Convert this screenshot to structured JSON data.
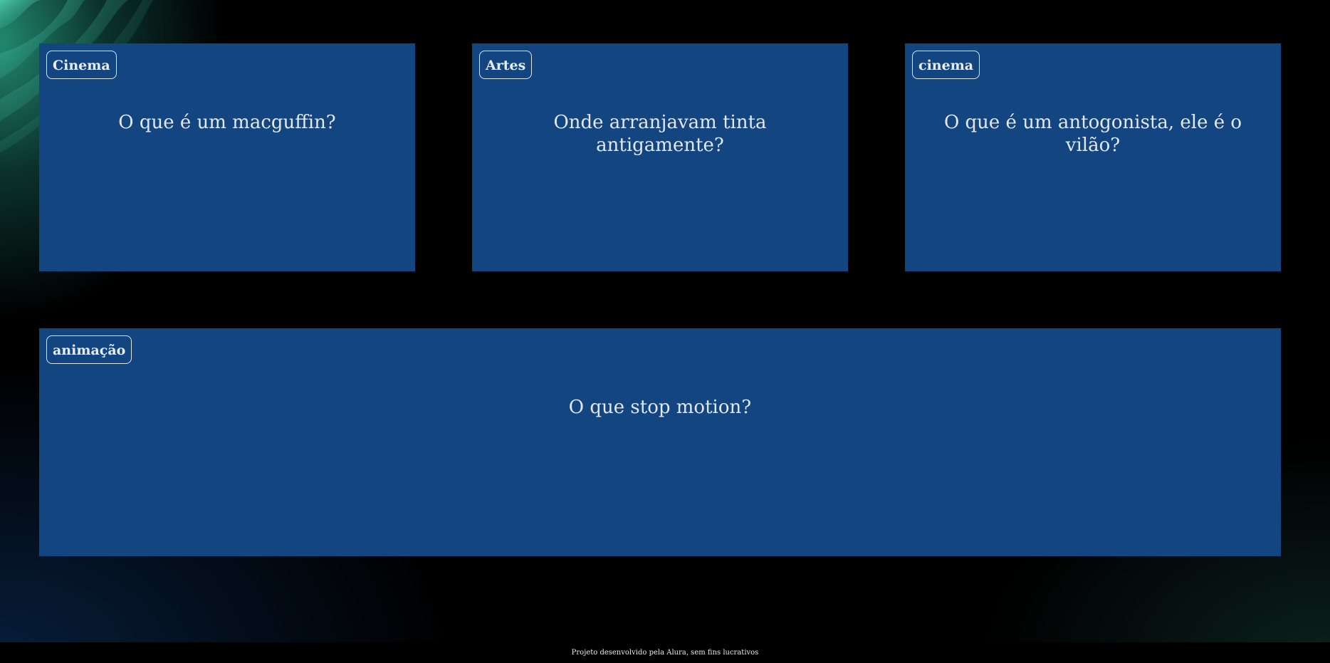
{
  "cards": [
    {
      "category": "Cinema",
      "question": "O que é um macguffin?"
    },
    {
      "category": "Artes",
      "question": "Onde arranjavam tinta antigamente?"
    },
    {
      "category": "cinema",
      "question": "O que é um antogonista, ele é o vilão?"
    },
    {
      "category": "animação",
      "question": "O que stop motion?"
    }
  ],
  "footer": {
    "text": "Projeto desenvolvido pela Alura, sem fins lucrativos"
  },
  "colors": {
    "card_background": "#134580",
    "page_background": "#000000",
    "accent_glow": "#2aa082"
  },
  "decorations": {
    "background_pattern_icon": "wave-pattern-icon"
  }
}
